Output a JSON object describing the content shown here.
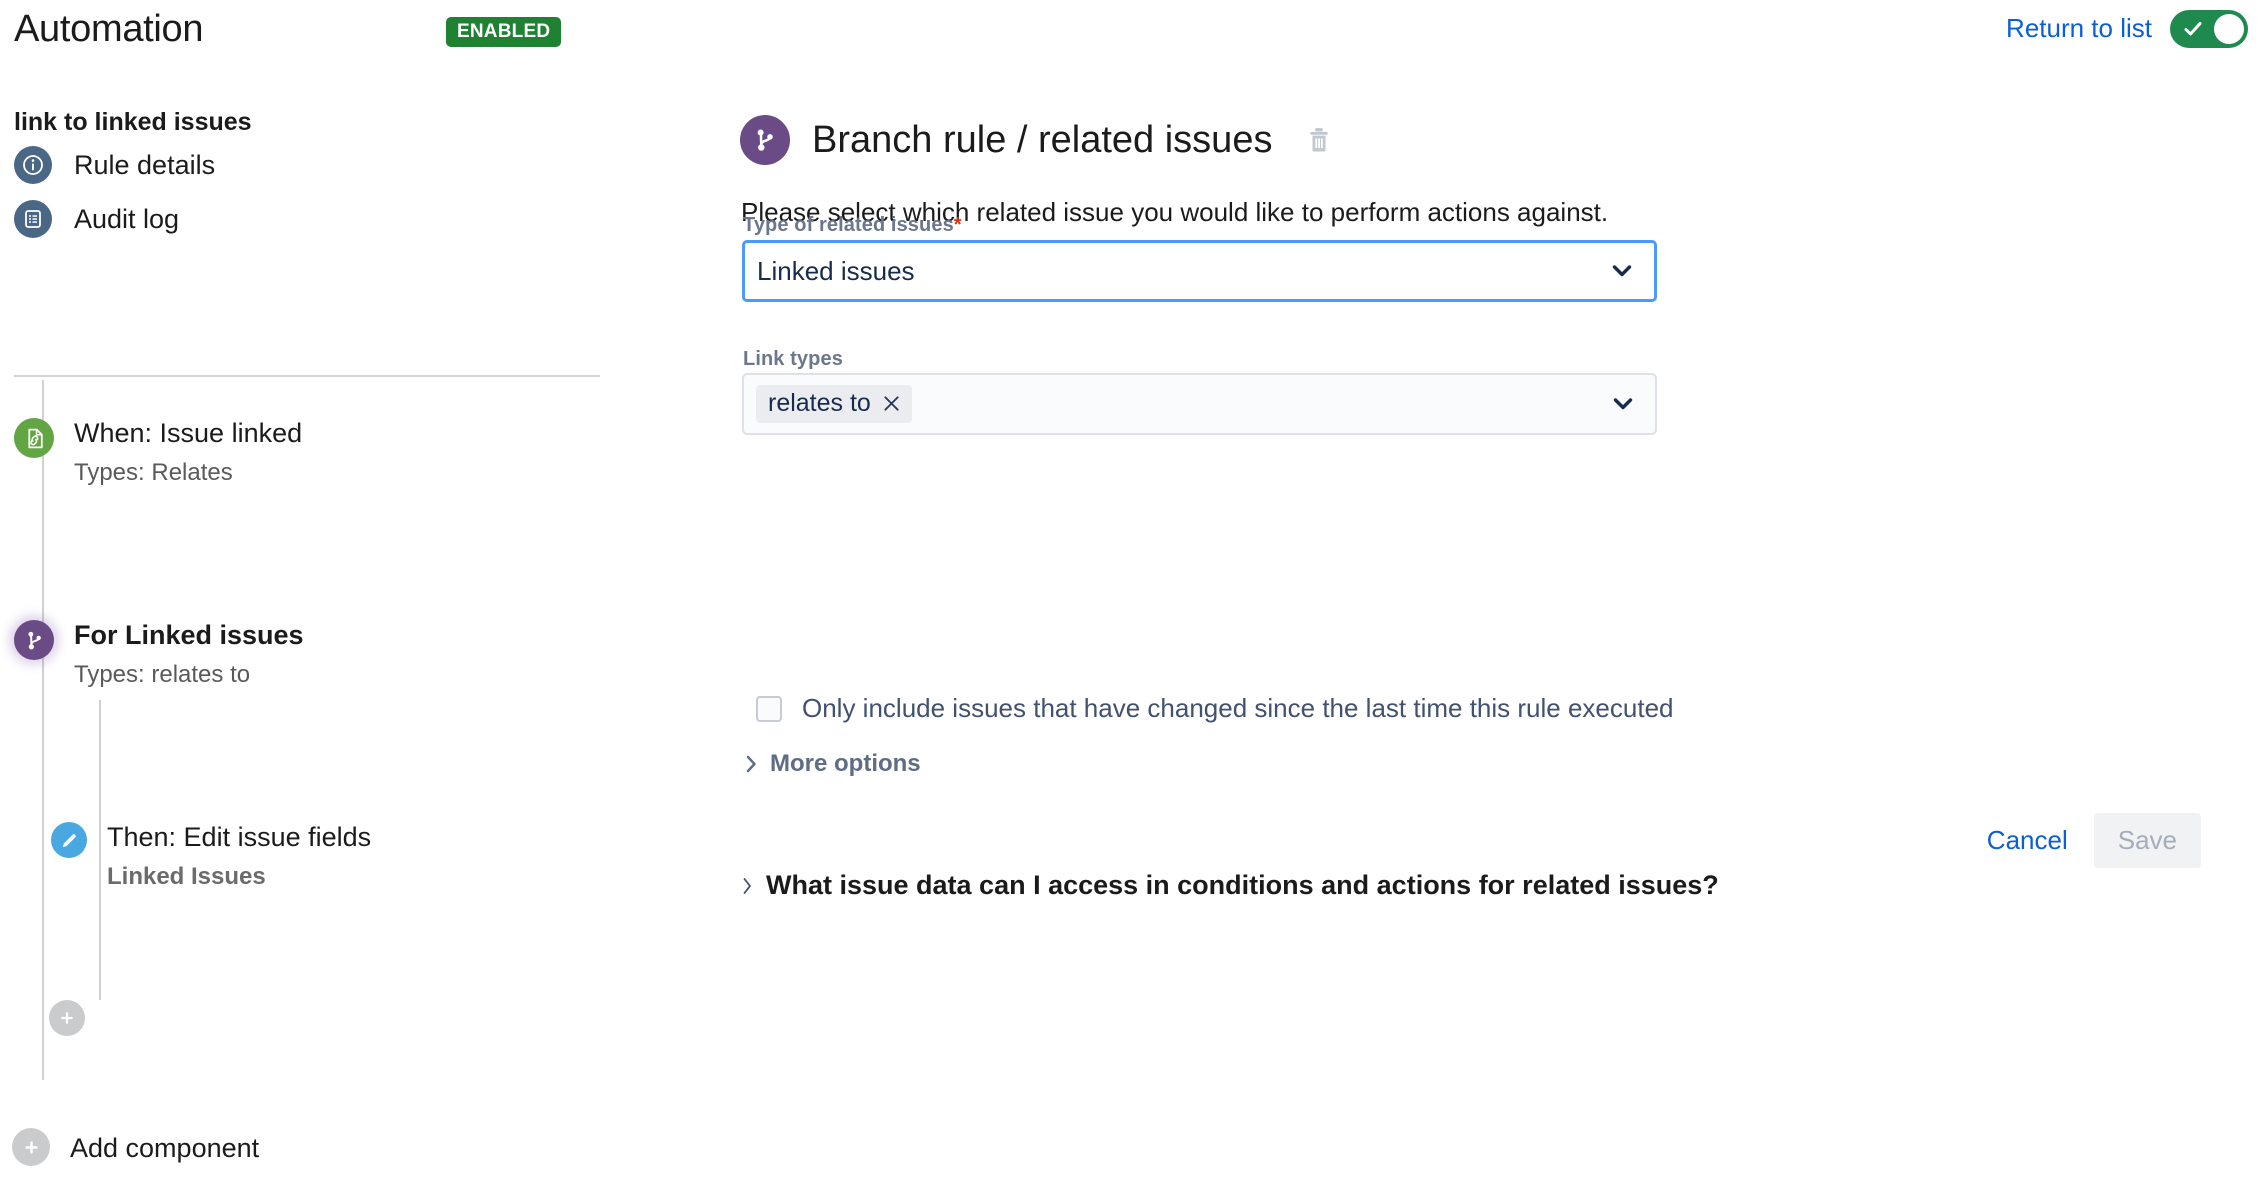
{
  "header": {
    "app_title": "Automation",
    "status_badge": "ENABLED",
    "return_link": "Return to list",
    "toggle_state": "on",
    "toggle_icon": "check-icon",
    "accent_green": "#1f8233",
    "toggle_green": "#1f8a4d",
    "link_blue": "#0a5fd4"
  },
  "sidebar": {
    "rule_name": "link to linked issues",
    "nav": [
      {
        "label": "Rule details",
        "icon": "info-circle-icon"
      },
      {
        "label": "Audit log",
        "icon": "list-document-icon"
      }
    ],
    "tree": [
      {
        "title": "When: Issue linked",
        "subtitle": "Types: Relates",
        "icon": "document-link-icon",
        "color": "#62a644",
        "bold": false
      },
      {
        "title": "For Linked issues",
        "subtitle": "Types: relates to",
        "icon": "branch-fork-icon",
        "color": "#6b4b86",
        "bold": true
      },
      {
        "title": "Then: Edit issue fields",
        "subtitle": "Linked Issues",
        "icon": "pencil-icon",
        "color": "#4aa8e0",
        "bold": false
      }
    ],
    "add_child_label": "",
    "add_component_label": "Add component",
    "add_icon": "plus-icon"
  },
  "main": {
    "panel_icon": "branch-fork-icon",
    "panel_title": "Branch rule / related issues",
    "delete_icon": "trash-icon",
    "panel_description": "Please select which related issue you would like to perform actions against.",
    "type_field": {
      "label": "Type of related issues",
      "required_marker": "*",
      "value": "Linked issues",
      "chevron_icon": "chevron-down-icon"
    },
    "link_types_field": {
      "label": "Link types",
      "chips": [
        {
          "label": "relates to",
          "remove_icon": "close-x-icon"
        }
      ],
      "chevron_icon": "chevron-down-icon"
    },
    "checkbox": {
      "label": "Only include issues that have changed since the last time this rule executed",
      "checked": false
    },
    "more_options": {
      "label": "More options",
      "chevron_icon": "chevron-right-icon",
      "expanded": false
    },
    "buttons": {
      "cancel": "Cancel",
      "save": "Save",
      "save_disabled": true
    },
    "faq": {
      "label": "What issue data can I access in conditions and actions for related issues?",
      "chevron_icon": "chevron-right-icon",
      "expanded": false
    }
  }
}
